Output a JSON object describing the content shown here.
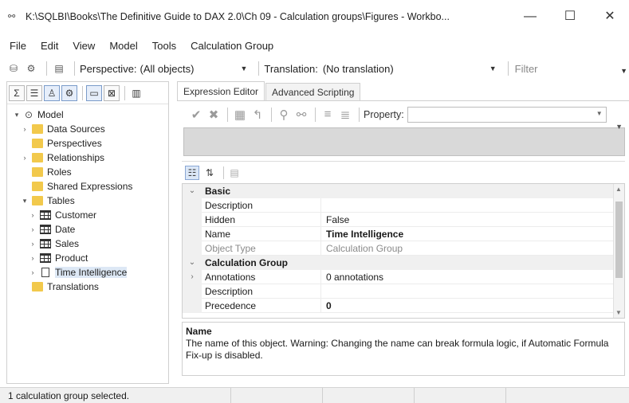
{
  "window": {
    "title": "K:\\SQLBI\\Books\\The Definitive Guide to DAX 2.0\\Ch 09 - Calculation groups\\Figures - Workbo...",
    "minimize": "—",
    "maximize": "☐",
    "close": "✕"
  },
  "menu": [
    "File",
    "Edit",
    "View",
    "Model",
    "Tools",
    "Calculation Group"
  ],
  "toolbar": {
    "perspective_label": "Perspective:",
    "perspective_value": "(All objects)",
    "translation_label": "Translation:",
    "translation_value": "(No translation)",
    "filter_placeholder": "Filter"
  },
  "tree": [
    {
      "label": "Model",
      "depth": 0,
      "toggle": "▾",
      "icon": "model-icon"
    },
    {
      "label": "Data Sources",
      "depth": 1,
      "toggle": "›",
      "icon": "folder-icon"
    },
    {
      "label": "Perspectives",
      "depth": 1,
      "toggle": "",
      "icon": "folder-icon"
    },
    {
      "label": "Relationships",
      "depth": 1,
      "toggle": "›",
      "icon": "folder-icon"
    },
    {
      "label": "Roles",
      "depth": 1,
      "toggle": "",
      "icon": "folder-icon"
    },
    {
      "label": "Shared Expressions",
      "depth": 1,
      "toggle": "",
      "icon": "folder-icon"
    },
    {
      "label": "Tables",
      "depth": 1,
      "toggle": "▾",
      "icon": "folder-icon"
    },
    {
      "label": "Customer",
      "depth": 2,
      "toggle": "›",
      "icon": "table-icon"
    },
    {
      "label": "Date",
      "depth": 2,
      "toggle": "›",
      "icon": "table-icon"
    },
    {
      "label": "Sales",
      "depth": 2,
      "toggle": "›",
      "icon": "table-icon"
    },
    {
      "label": "Product",
      "depth": 2,
      "toggle": "›",
      "icon": "table-icon"
    },
    {
      "label": "Time Intelligence",
      "depth": 2,
      "toggle": "›",
      "icon": "calculation-group-icon",
      "selected": true
    },
    {
      "label": "Translations",
      "depth": 1,
      "toggle": "",
      "icon": "folder-icon"
    }
  ],
  "tabs": [
    "Expression Editor",
    "Advanced Scripting"
  ],
  "editor": {
    "property_label": "Property:"
  },
  "grid": [
    {
      "type": "cat",
      "toggle": "⌄",
      "name": "Basic",
      "value": ""
    },
    {
      "type": "row",
      "name": "Description",
      "value": ""
    },
    {
      "type": "row",
      "name": "Hidden",
      "value": "False"
    },
    {
      "type": "row",
      "name": "Name",
      "value": "Time Intelligence",
      "bold": true
    },
    {
      "type": "ro",
      "name": "Object Type",
      "value": "Calculation Group"
    },
    {
      "type": "cat",
      "toggle": "⌄",
      "name": "Calculation Group",
      "value": ""
    },
    {
      "type": "row",
      "toggle": "›",
      "name": "Annotations",
      "value": "0 annotations"
    },
    {
      "type": "row",
      "name": "Description",
      "value": ""
    },
    {
      "type": "row",
      "name": "Precedence",
      "value": "0",
      "bold": true
    }
  ],
  "description": {
    "title": "Name",
    "text": "The name of this object. Warning: Changing the name can break formula logic, if Automatic Formula Fix-up is disabled."
  },
  "status": {
    "text": "1 calculation group selected."
  }
}
